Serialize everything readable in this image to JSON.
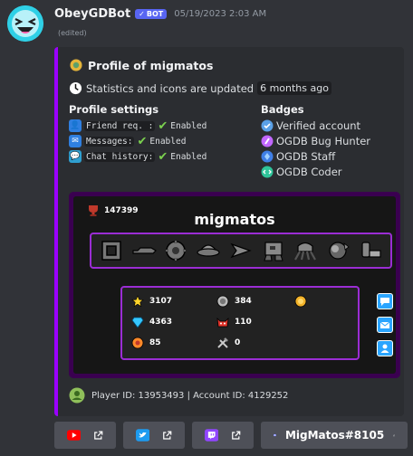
{
  "message": {
    "username": "ObeyGDBot",
    "bot_tag": "BOT",
    "timestamp": "05/19/2023 2:03 AM",
    "edited": "(edited)"
  },
  "embed": {
    "accent_color": "#9b00ff",
    "title": "Profile of migmatos",
    "stats_note": "Statistics and icons are updated",
    "stats_age": "6 months ago",
    "profile_settings": {
      "title": "Profile settings",
      "items": [
        {
          "label": "Friend req. :",
          "value": "Enabled"
        },
        {
          "label": "Messages:",
          "value": "Enabled"
        },
        {
          "label": "Chat history:",
          "value": "Enabled"
        }
      ]
    },
    "badges": {
      "title": "Badges",
      "items": [
        {
          "label": "Verified account",
          "icon": "verified-icon",
          "color": "#5aa0e6"
        },
        {
          "label": "OGDB Bug Hunter",
          "icon": "bug-hunter-icon",
          "color": "#c167ff"
        },
        {
          "label": "OGDB Staff",
          "icon": "staff-icon",
          "color": "#3f7fe6"
        },
        {
          "label": "OGDB Coder",
          "icon": "coder-icon",
          "color": "#2fc49a"
        }
      ]
    },
    "card": {
      "rank_value": "147399",
      "player_name": "migmatos",
      "stats": [
        {
          "name": "stars",
          "value": "3107",
          "icon": "star-icon"
        },
        {
          "name": "secret-coins",
          "value": "384",
          "icon": "secret-coin-icon"
        },
        {
          "name": "user-coins",
          "value": "",
          "icon": "user-coin-icon"
        },
        {
          "name": "diamonds",
          "value": "4363",
          "icon": "diamond-icon"
        },
        {
          "name": "demons",
          "value": "110",
          "icon": "demon-icon"
        },
        {
          "name": "orbs",
          "value": "85",
          "icon": "moon-orb-icon"
        },
        {
          "name": "creator-points",
          "value": "0",
          "icon": "creator-points-icon"
        }
      ]
    },
    "footer": "Player ID: 13953493 | Account ID: 4129252"
  },
  "buttons": [
    {
      "name": "youtube",
      "label": "",
      "icon": "youtube-icon",
      "color": "#ff0000"
    },
    {
      "name": "twitter",
      "label": "",
      "icon": "twitter-icon",
      "color": "#1d9bf0"
    },
    {
      "name": "twitch",
      "label": "",
      "icon": "twitch-icon",
      "color": "#9146ff"
    },
    {
      "name": "discord",
      "label": "MigMatos#8105",
      "icon": "discord-icon",
      "color": "#5865f2"
    }
  ]
}
